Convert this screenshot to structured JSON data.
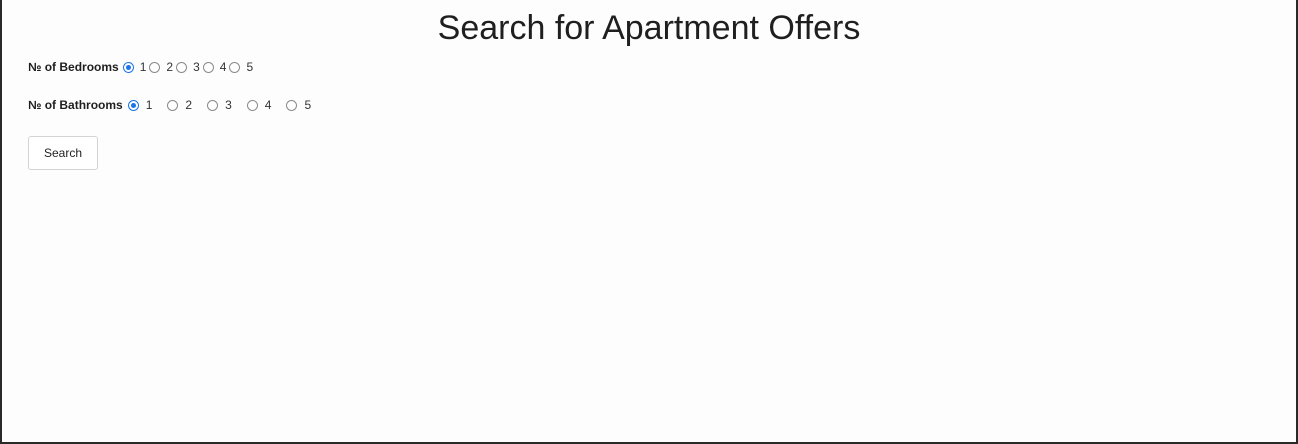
{
  "header": {
    "title": "Search for Apartment Offers"
  },
  "bedrooms": {
    "label": "№ of Bedrooms",
    "options": [
      "1",
      "2",
      "3",
      "4",
      "5"
    ],
    "selected": "1"
  },
  "bathrooms": {
    "label": "№ of Bathrooms",
    "options": [
      "1",
      "2",
      "3",
      "4",
      "5"
    ],
    "selected": "1"
  },
  "actions": {
    "search_label": "Search"
  },
  "colors": {
    "accent": "#1a73e8",
    "text": "#222222",
    "border": "#2a2a2a"
  }
}
